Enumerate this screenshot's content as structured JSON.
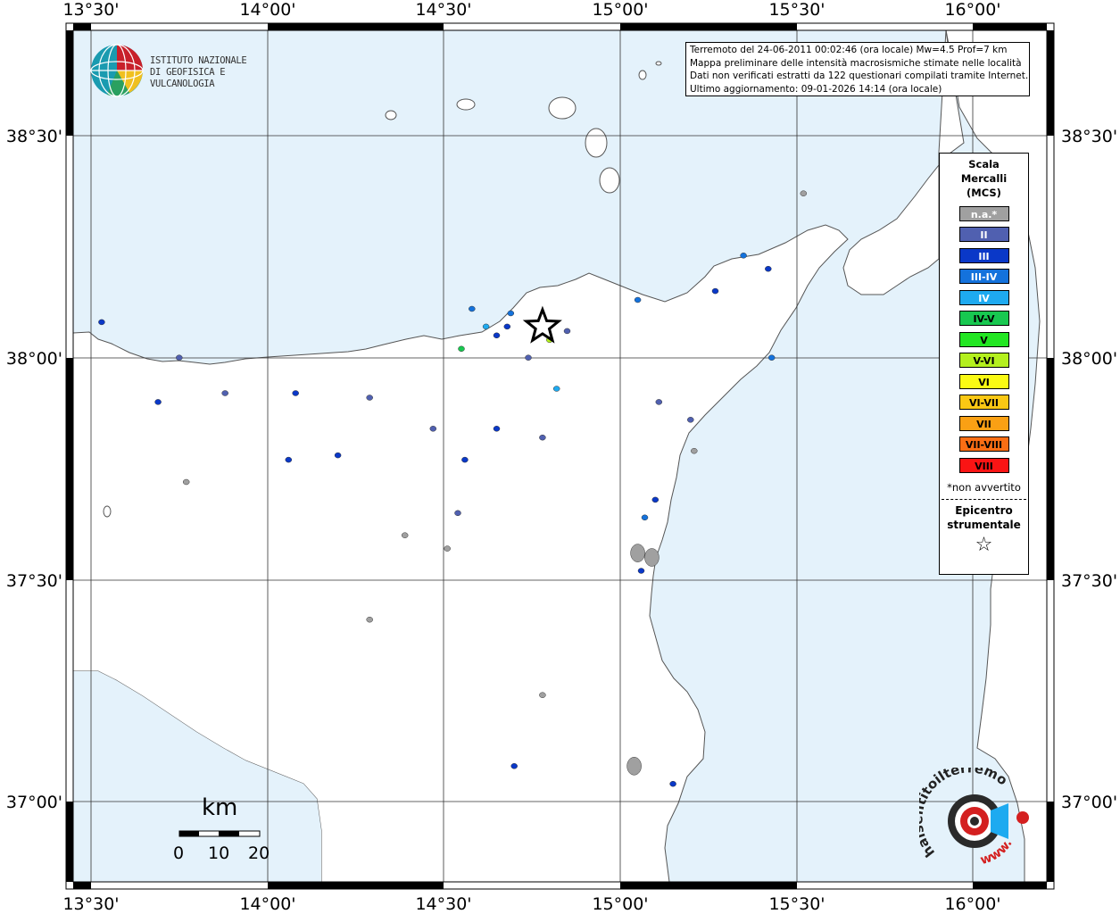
{
  "axes": {
    "top_lon_labels": [
      "13°30'",
      "14°00'",
      "14°30'",
      "15°00'",
      "15°30'",
      "16°00'"
    ],
    "bottom_lon_labels": [
      "13°30'",
      "14°00'",
      "14°30'",
      "15°00'",
      "15°30'",
      "16°00'"
    ],
    "left_lat_labels": [
      "38°30'",
      "38°00'",
      "37°30'",
      "37°00'"
    ],
    "right_lat_labels": [
      "38°30'",
      "38°00'",
      "37°30'",
      "37°00'"
    ]
  },
  "info": {
    "line1": "Terremoto del 24-06-2011 00:02:46 (ora locale) Mw=4.5 Prof=7 km",
    "line2": "Mappa preliminare delle intensità macrosismiche stimate nelle località",
    "line3": "Dati non verificati estratti da 122 questionari compilati tramite Internet.",
    "line4": "Ultimo aggiornamento: 09-01-2026 14:14 (ora locale)"
  },
  "logo": {
    "line1": "ISTITUTO NAZIONALE",
    "line2": "DI GEOFISICA E VULCANOLOGIA"
  },
  "legend": {
    "title1": "Scala",
    "title2": "Mercalli",
    "title3": "(MCS)",
    "items": [
      {
        "label": "n.a.*",
        "color": "#a0a0a0",
        "text_color": "#ffffff"
      },
      {
        "label": "II",
        "color": "#5060b0",
        "text_color": "#ffffff"
      },
      {
        "label": "III",
        "color": "#0a38c8",
        "text_color": "#ffffff"
      },
      {
        "label": "III-IV",
        "color": "#1472dc",
        "text_color": "#ffffff"
      },
      {
        "label": "IV",
        "color": "#1eaaf0",
        "text_color": "#ffffff"
      },
      {
        "label": "IV-V",
        "color": "#18c850",
        "text_color": "#000000"
      },
      {
        "label": "V",
        "color": "#22e622",
        "text_color": "#000000"
      },
      {
        "label": "V-VI",
        "color": "#b4f01e",
        "text_color": "#000000"
      },
      {
        "label": "VI",
        "color": "#fafa14",
        "text_color": "#000000"
      },
      {
        "label": "VI-VII",
        "color": "#fac814",
        "text_color": "#000000"
      },
      {
        "label": "VII",
        "color": "#faa014",
        "text_color": "#000000"
      },
      {
        "label": "VII-VIII",
        "color": "#fa6e14",
        "text_color": "#000000"
      },
      {
        "label": "VIII",
        "color": "#fa1414",
        "text_color": "#000000"
      }
    ],
    "note": "*non avvertito",
    "epicenter1": "Epicentro",
    "epicenter2": "strumentale",
    "epicenter_symbol": "☆"
  },
  "scale_bar": {
    "unit": "km",
    "ticks": [
      "0",
      "10",
      "20"
    ]
  },
  "brand": {
    "text": "haisentitoilterremoto.it",
    "www": "www."
  },
  "colors": {
    "sea": "#e4f2fb",
    "land": "#ffffff",
    "coast": "#555555",
    "grid": "#333333"
  },
  "places": [
    {
      "lon": 13.53,
      "lat": 38.08,
      "level": "III"
    },
    {
      "lon": 13.75,
      "lat": 38.0,
      "level": "II"
    },
    {
      "lon": 13.69,
      "lat": 37.9,
      "level": "III"
    },
    {
      "lon": 13.88,
      "lat": 37.92,
      "level": "II"
    },
    {
      "lon": 14.08,
      "lat": 37.92,
      "level": "III"
    },
    {
      "lon": 14.29,
      "lat": 37.91,
      "level": "II"
    },
    {
      "lon": 14.06,
      "lat": 37.77,
      "level": "III"
    },
    {
      "lon": 14.2,
      "lat": 37.78,
      "level": "III"
    },
    {
      "lon": 13.77,
      "lat": 37.72,
      "level": "n.a.*"
    },
    {
      "lon": 14.47,
      "lat": 37.84,
      "level": "II"
    },
    {
      "lon": 14.56,
      "lat": 37.77,
      "level": "III"
    },
    {
      "lon": 14.54,
      "lat": 37.65,
      "level": "II"
    },
    {
      "lon": 14.39,
      "lat": 37.6,
      "level": "n.a.*"
    },
    {
      "lon": 14.51,
      "lat": 37.57,
      "level": "n.a.*"
    },
    {
      "lon": 14.65,
      "lat": 37.84,
      "level": "III"
    },
    {
      "lon": 14.78,
      "lat": 37.82,
      "level": "II"
    },
    {
      "lon": 14.82,
      "lat": 37.93,
      "level": "IV"
    },
    {
      "lon": 14.74,
      "lat": 38.0,
      "level": "II"
    },
    {
      "lon": 14.58,
      "lat": 38.11,
      "level": "III-IV"
    },
    {
      "lon": 14.62,
      "lat": 38.07,
      "level": "IV"
    },
    {
      "lon": 14.65,
      "lat": 38.05,
      "level": "III"
    },
    {
      "lon": 14.55,
      "lat": 38.02,
      "level": "IV-V"
    },
    {
      "lon": 14.68,
      "lat": 38.07,
      "level": "III"
    },
    {
      "lon": 14.8,
      "lat": 38.04,
      "level": "V-VI"
    },
    {
      "lon": 14.85,
      "lat": 38.06,
      "level": "II"
    },
    {
      "lon": 14.69,
      "lat": 38.1,
      "level": "III-IV"
    },
    {
      "lon": 15.05,
      "lat": 38.13,
      "level": "III-IV"
    },
    {
      "lon": 15.27,
      "lat": 38.15,
      "level": "III"
    },
    {
      "lon": 15.35,
      "lat": 38.23,
      "level": "III-IV"
    },
    {
      "lon": 15.42,
      "lat": 38.2,
      "level": "III"
    },
    {
      "lon": 15.43,
      "lat": 38.0,
      "level": "III-IV"
    },
    {
      "lon": 15.11,
      "lat": 37.9,
      "level": "II"
    },
    {
      "lon": 15.2,
      "lat": 37.86,
      "level": "II"
    },
    {
      "lon": 15.21,
      "lat": 37.79,
      "level": "n.a.*"
    },
    {
      "lon": 15.1,
      "lat": 37.68,
      "level": "III"
    },
    {
      "lon": 15.07,
      "lat": 37.64,
      "level": "III-IV"
    },
    {
      "lon": 15.05,
      "lat": 37.56,
      "level": "n.a.*"
    },
    {
      "lon": 15.09,
      "lat": 37.55,
      "level": "n.a.*"
    },
    {
      "lon": 15.06,
      "lat": 37.52,
      "level": "III"
    },
    {
      "lon": 14.29,
      "lat": 37.41,
      "level": "n.a.*"
    },
    {
      "lon": 14.78,
      "lat": 37.24,
      "level": "n.a.*"
    },
    {
      "lon": 14.7,
      "lat": 37.08,
      "level": "III"
    },
    {
      "lon": 15.04,
      "lat": 37.08,
      "level": "n.a.*"
    },
    {
      "lon": 15.15,
      "lat": 37.04,
      "level": "III"
    },
    {
      "lon": 15.52,
      "lat": 38.37,
      "level": "n.a.*"
    },
    {
      "lon": 16.05,
      "lat": 38.45,
      "level": "III-IV"
    }
  ],
  "epicenter": {
    "lon": 14.78,
    "lat": 38.07
  }
}
